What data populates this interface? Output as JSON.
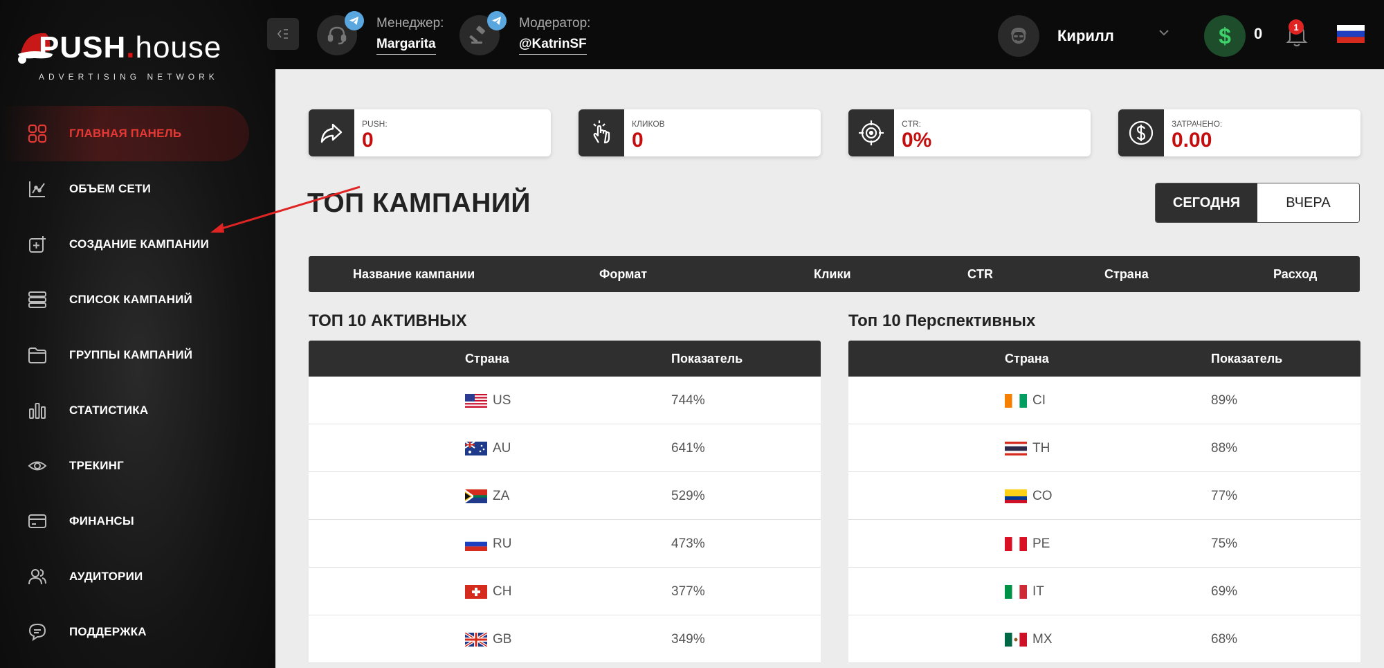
{
  "logo": {
    "push": "PUSH",
    "dot": ".",
    "house": "house",
    "subtitle": "ADVERTISING NETWORK"
  },
  "sidebar": {
    "items": [
      {
        "label": "ГЛАВНАЯ ПАНЕЛЬ",
        "icon": "dashboard-icon",
        "active": true
      },
      {
        "label": "ОБЪЕМ СЕТИ",
        "icon": "chart-line-icon"
      },
      {
        "label": "СОЗДАНИЕ КАМПАНИИ",
        "icon": "add-square-icon"
      },
      {
        "label": "СПИСОК КАМПАНИЙ",
        "icon": "list-icon"
      },
      {
        "label": "ГРУППЫ КАМПАНИЙ",
        "icon": "folder-icon"
      },
      {
        "label": "СТАТИСТИКА",
        "icon": "bar-chart-icon"
      },
      {
        "label": "ТРЕКИНГ",
        "icon": "eye-icon"
      },
      {
        "label": "ФИНАНСЫ",
        "icon": "credit-card-icon"
      },
      {
        "label": "АУДИТОРИИ",
        "icon": "users-icon"
      },
      {
        "label": "ПОДДЕРЖКА",
        "icon": "support-chat-icon"
      }
    ]
  },
  "topbar": {
    "manager": {
      "role": "Менеджер:",
      "name": "Margarita"
    },
    "moderator": {
      "role": "Модератор:",
      "name": "@KatrinSF"
    },
    "user": {
      "name": "Кирилл"
    },
    "balance": {
      "symbol": "$",
      "value": "0"
    },
    "notifications": {
      "count": "1"
    },
    "language_flag": "ru"
  },
  "stats": [
    {
      "label": "PUSH:",
      "value": "0",
      "icon": "share-arrow-icon"
    },
    {
      "label": "КЛИКОВ",
      "value": "0",
      "icon": "tap-hand-icon"
    },
    {
      "label": "CTR:",
      "value": "0%",
      "icon": "target-icon"
    },
    {
      "label": "ЗАТРАЧЕНО:",
      "value": "0.00",
      "icon": "dollar-circle-icon"
    }
  ],
  "main": {
    "title": "ТОП КАМПАНИЙ",
    "tabs": [
      {
        "label": "СЕГОДНЯ",
        "active": true
      },
      {
        "label": "ВЧЕРА"
      }
    ],
    "campaign_columns": [
      "Название кампании",
      "Формат",
      "Клики",
      "CTR",
      "Страна",
      "Расход"
    ]
  },
  "active": {
    "title": "ТОП 10 АКТИВНЫХ",
    "columns": [
      "Страна",
      "Показатель"
    ],
    "rows": [
      {
        "code": "US",
        "value": "744%"
      },
      {
        "code": "AU",
        "value": "641%"
      },
      {
        "code": "ZA",
        "value": "529%"
      },
      {
        "code": "RU",
        "value": "473%"
      },
      {
        "code": "CH",
        "value": "377%"
      },
      {
        "code": "GB",
        "value": "349%"
      }
    ]
  },
  "perspective": {
    "title": "Топ 10 Перспективных",
    "columns": [
      "Страна",
      "Показатель"
    ],
    "rows": [
      {
        "code": "CI",
        "value": "89%"
      },
      {
        "code": "TH",
        "value": "88%"
      },
      {
        "code": "CO",
        "value": "77%"
      },
      {
        "code": "PE",
        "value": "75%"
      },
      {
        "code": "IT",
        "value": "69%"
      },
      {
        "code": "MX",
        "value": "68%"
      }
    ]
  },
  "colors": {
    "accent_red": "#c40d0d",
    "dark": "#2f2f2f",
    "sidebar_bg": "#141414",
    "balance_green": "#3ed16a"
  }
}
